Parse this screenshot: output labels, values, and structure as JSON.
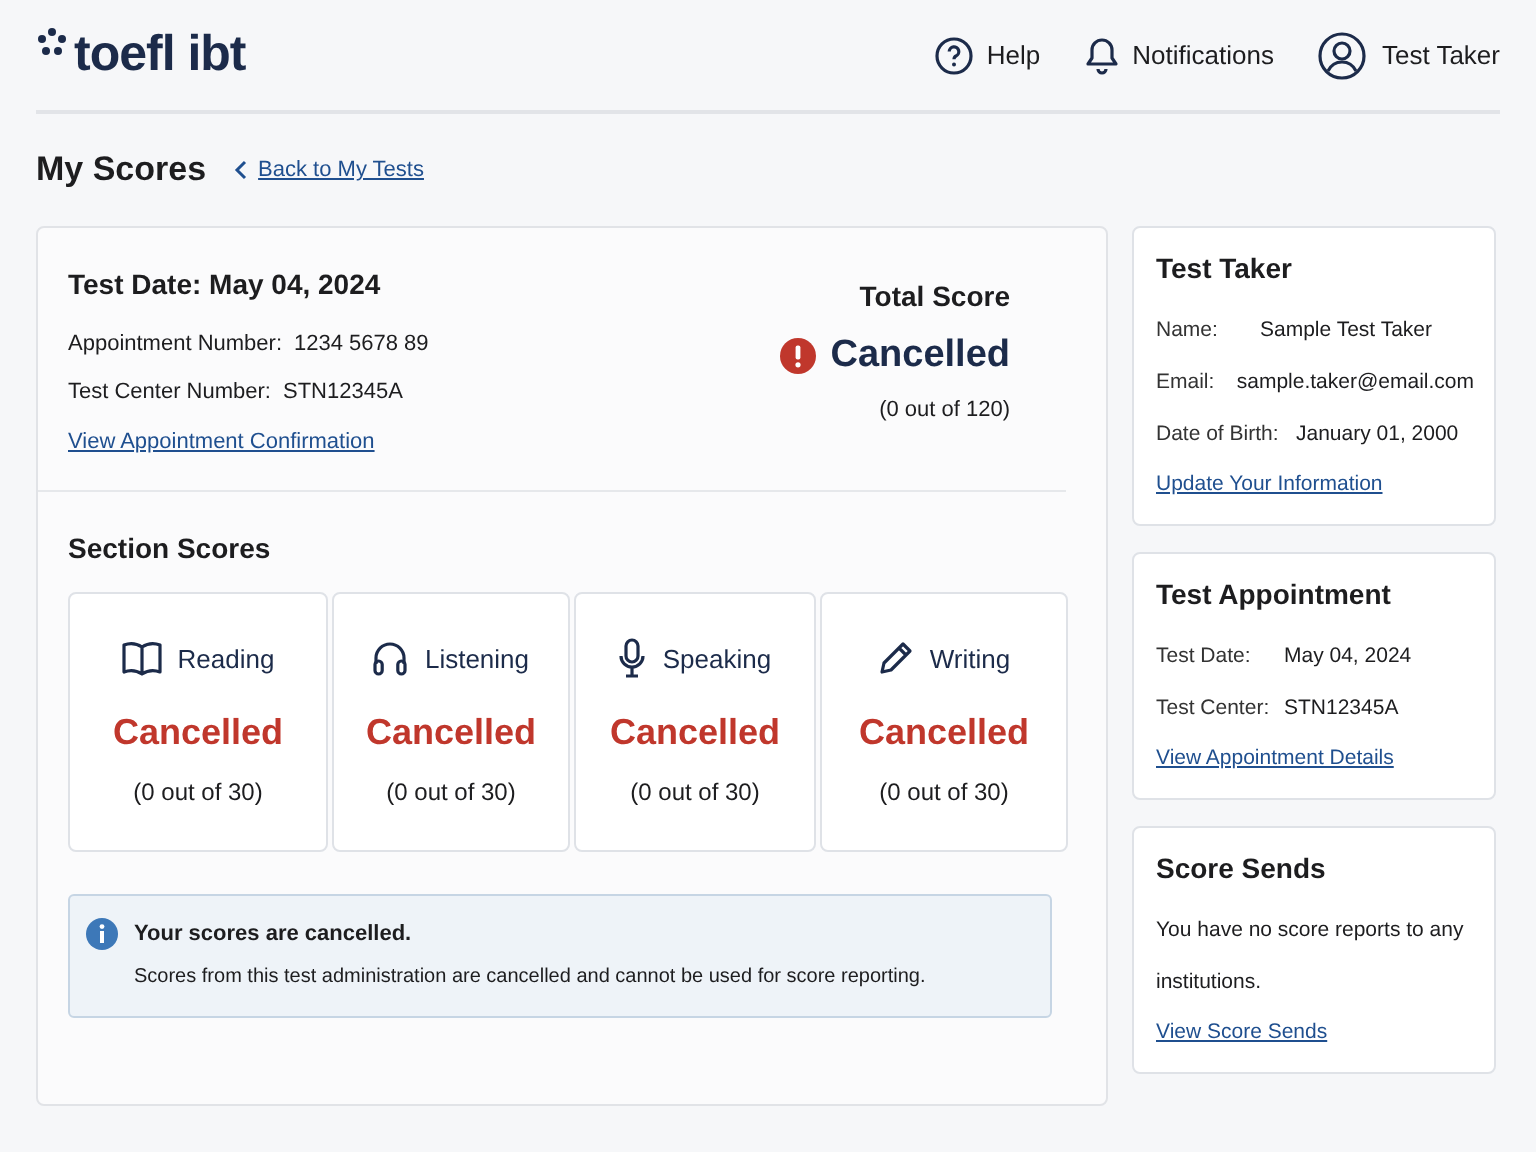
{
  "header": {
    "logo": "toefl ibt",
    "nav": [
      {
        "kind": "help",
        "label": "Help"
      },
      {
        "kind": "notifications",
        "label": "Notifications"
      },
      {
        "kind": "account",
        "label": "Test Taker"
      }
    ]
  },
  "page": {
    "title": "My Scores",
    "back_link": "Back to My Tests"
  },
  "test": {
    "date": "Test Date: May 04, 2024",
    "fields": [
      {
        "label": "Appointment Number:",
        "value": "1234 5678 89"
      },
      {
        "label": "Test Center Number:",
        "value": "STN12345A"
      }
    ],
    "link": "View Appointment Confirmation"
  },
  "total_score": {
    "title": "Total Score",
    "status": "Cancelled",
    "alert": true,
    "range": "(0 out of 120)"
  },
  "section_scores": {
    "title": "Section Scores",
    "sections": [
      {
        "kind": "reading",
        "name": "Reading",
        "status": "Cancelled",
        "range": "(0 out of 30)"
      },
      {
        "kind": "listening",
        "name": "Listening",
        "status": "Cancelled",
        "range": "(0 out of 30)"
      },
      {
        "kind": "speaking",
        "name": "Speaking",
        "status": "Cancelled",
        "range": "(0 out of 30)"
      },
      {
        "kind": "writing",
        "name": "Writing",
        "status": "Cancelled",
        "range": "(0 out of 30)"
      }
    ]
  },
  "notice": {
    "title": "Your scores are cancelled.",
    "message": "Scores from this test administration are cancelled and cannot be used for score reporting."
  },
  "sidebar": [
    {
      "title": "Test Taker",
      "fields": [
        {
          "label": "Name:",
          "value": "Sample Test Taker"
        },
        {
          "label": "Email:",
          "value": "sample.taker@email.com"
        },
        {
          "label": "Date of Birth:",
          "value": "January 01, 2000"
        }
      ],
      "link": "Update Your Information"
    },
    {
      "title": "Test Appointment",
      "fields": [
        {
          "label": "Test Date:",
          "value": "May 04, 2024"
        },
        {
          "label": "Test Center:",
          "value": "STN12345A"
        }
      ],
      "link": "View Appointment Details"
    },
    {
      "title": "Score Sends",
      "message": "You have no score reports to any institutions.",
      "link": "View Score Sends"
    }
  ]
}
